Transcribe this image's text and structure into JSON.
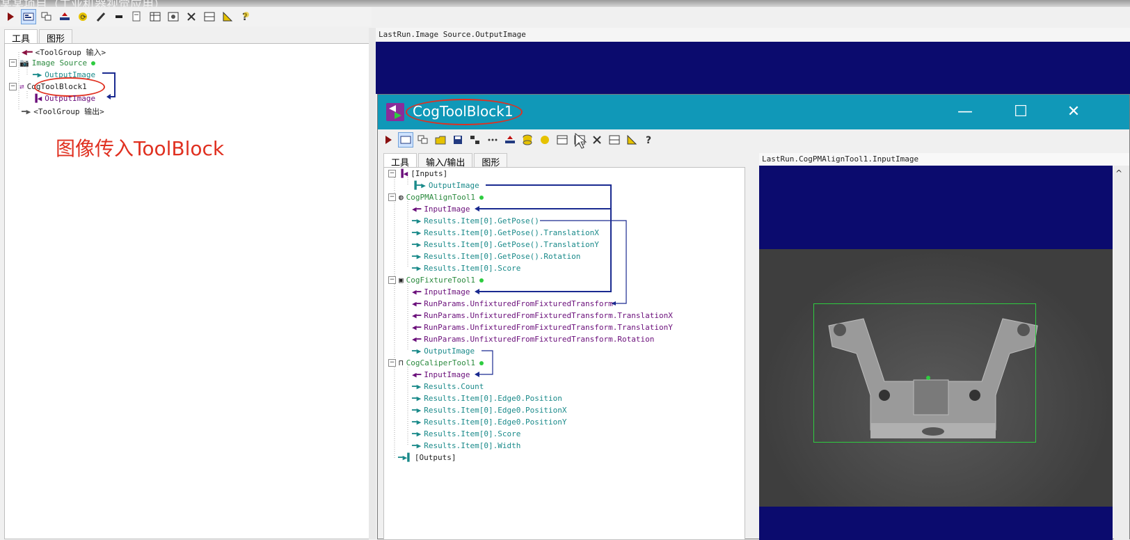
{
  "window_title": "某某项目（工业机器视觉应用）",
  "main_toolbar": {
    "icons": [
      "run-icon",
      "display-icon",
      "layers-icon",
      "import-icon",
      "refresh-icon",
      "brush-icon",
      "record-icon",
      "edit-icon",
      "table-icon",
      "image-icon",
      "tools-icon",
      "grid-icon",
      "measure-icon",
      "help-icon"
    ]
  },
  "left_tabs": {
    "tools": "工具",
    "graphics": "图形"
  },
  "left_tree": {
    "input_group": "<ToolGroup 输入>",
    "image_source": "Image Source",
    "output_image_1": "OutputImage",
    "tool_block": "CogToolBlock1",
    "output_image_2": "OutputImage",
    "output_group": "<ToolGroup 输出>"
  },
  "annotation": "图像传入ToolBlock",
  "right_header": "LastRun.Image Source.OutputImage",
  "toolblock": {
    "title": "CogToolBlock1",
    "window_buttons": {
      "minimize": "—",
      "maximize": "☐",
      "close": "✕"
    },
    "tabs": {
      "tools": "工具",
      "io": "输入/输出",
      "graphics": "图形"
    },
    "image_header": "LastRun.CogPMAlignTool1.InputImage",
    "tree": {
      "inputs": "[Inputs]",
      "in_output_image": "OutputImage",
      "pmalign": "CogPMAlignTool1",
      "pm_input": "InputImage",
      "pm_pose": "Results.Item[0].GetPose()",
      "pm_tx": "Results.Item[0].GetPose().TranslationX",
      "pm_ty": "Results.Item[0].GetPose().TranslationY",
      "pm_rot": "Results.Item[0].GetPose().Rotation",
      "pm_score": "Results.Item[0].Score",
      "fixture": "CogFixtureTool1",
      "fx_input": "InputImage",
      "fx_unfix": "RunParams.UnfixturedFromFixturedTransform",
      "fx_tx": "RunParams.UnfixturedFromFixturedTransform.TranslationX",
      "fx_ty": "RunParams.UnfixturedFromFixturedTransform.TranslationY",
      "fx_rot": "RunParams.UnfixturedFromFixturedTransform.Rotation",
      "fx_output": "OutputImage",
      "caliper": "CogCaliperTool1",
      "cal_input": "InputImage",
      "cal_count": "Results.Count",
      "cal_edge_pos": "Results.Item[0].Edge0.Position",
      "cal_edge_x": "Results.Item[0].Edge0.PositionX",
      "cal_edge_y": "Results.Item[0].Edge0.PositionY",
      "cal_score": "Results.Item[0].Score",
      "cal_width": "Results.Item[0].Width",
      "outputs": "[Outputs]"
    }
  },
  "colors": {
    "accent": "#1098b8",
    "image_bg": "#0b0b6e",
    "annotation": "#e03020",
    "roi": "#2ecc40"
  }
}
